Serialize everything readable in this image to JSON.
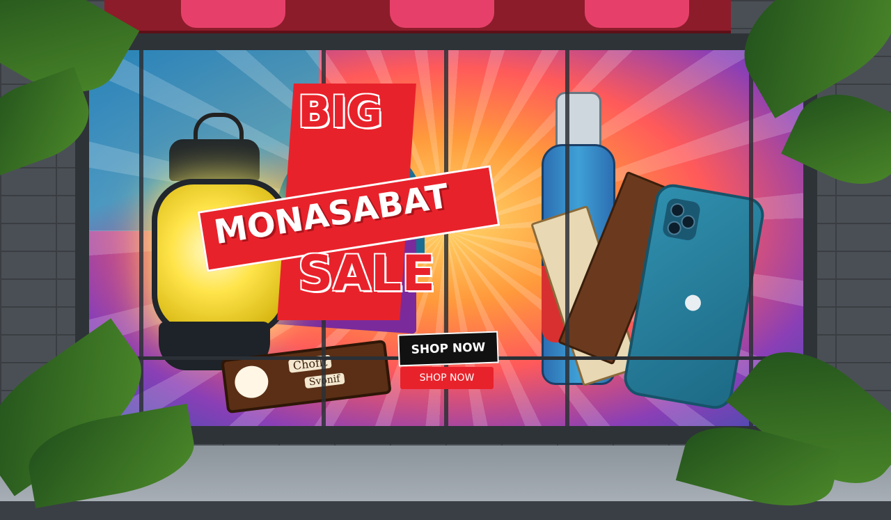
{
  "scene": {
    "headline": {
      "line1": "BIG",
      "line2": "MONASABAT",
      "line3": "SALE"
    },
    "buttons": {
      "primary_label": "SHOP NOW",
      "secondary_label": "SHOP NOW"
    },
    "chocolate_wrapper": {
      "line1": "Choflt",
      "line2": "Svonif"
    },
    "colors": {
      "headline_red": "#e8222b",
      "button_black": "#111111",
      "awning_pink": "#e6406a"
    },
    "icons": [
      "lantern-icon",
      "handbag-icon",
      "bottle-icon",
      "chocolate-bar-icon",
      "smartphone-icon",
      "apple-logo-icon"
    ]
  }
}
